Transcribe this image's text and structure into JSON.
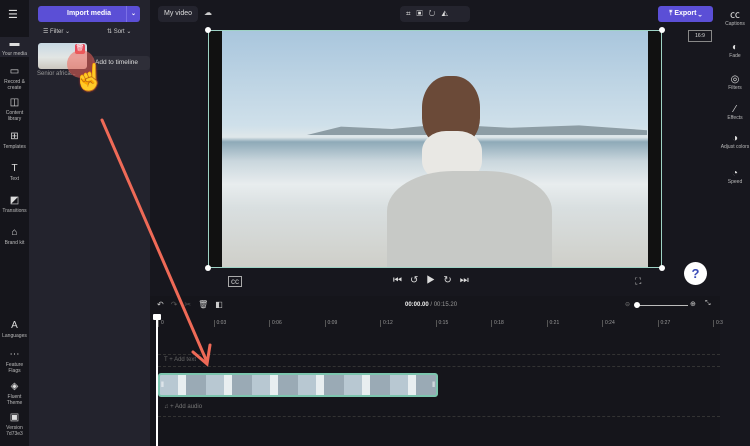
{
  "nav": {
    "items": [
      {
        "label": "Your media",
        "icon": "folder-icon"
      },
      {
        "label": "Record & create",
        "icon": "camera-icon"
      },
      {
        "label": "Content library",
        "icon": "library-icon"
      },
      {
        "label": "Templates",
        "icon": "templates-icon"
      },
      {
        "label": "Text",
        "icon": "text-icon"
      },
      {
        "label": "Transitions",
        "icon": "transitions-icon"
      },
      {
        "label": "Brand kit",
        "icon": "brand-kit-icon"
      }
    ],
    "bottom": [
      {
        "label": "Languages",
        "icon": "languages-icon"
      },
      {
        "label": "Feature Flags",
        "icon": "more-icon"
      },
      {
        "label": "Fluent Theme",
        "icon": "theme-icon"
      },
      {
        "label": "Version 7d73e3",
        "icon": "archive-icon"
      }
    ]
  },
  "panel": {
    "import_label": "Import media",
    "filter_label": "Filter",
    "sort_label": "Sort",
    "media_name": "Senior africa...",
    "tooltip": "Add to timeline"
  },
  "header": {
    "project_name": "My video",
    "export_label": "Export",
    "aspect_ratio": "16:9"
  },
  "right": {
    "items": [
      {
        "label": "Captions"
      },
      {
        "label": "Fade"
      },
      {
        "label": "Filters"
      },
      {
        "label": "Effects"
      },
      {
        "label": "Adjust colors"
      },
      {
        "label": "Speed"
      }
    ]
  },
  "help": "?",
  "timeline": {
    "current_time": "00:00.00",
    "total_time": "/ 00:15.20",
    "ticks": [
      "0",
      "0:03",
      "0:06",
      "0:09",
      "0:12",
      "0:15",
      "0:18",
      "0:21",
      "0:24",
      "0:27",
      "0:3"
    ],
    "add_text": "+ Add text",
    "add_audio": "+ Add audio"
  }
}
